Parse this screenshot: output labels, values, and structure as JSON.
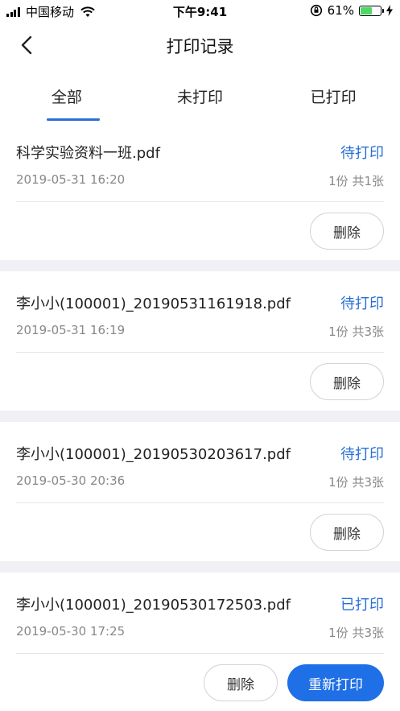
{
  "status_bar": {
    "carrier": "中国移动",
    "time": "下午9:41",
    "battery_percent": "61%",
    "battery_level": 0.61,
    "battery_color": "#4cd964"
  },
  "nav": {
    "title": "打印记录",
    "back_icon": "chevron-left-icon"
  },
  "tabs": [
    {
      "label": "全部",
      "active": true
    },
    {
      "label": "未打印",
      "active": false
    },
    {
      "label": "已打印",
      "active": false
    }
  ],
  "colors": {
    "accent": "#2a6fd6",
    "primary_button": "#1f6fe6",
    "background": "#f1f1f5"
  },
  "records": [
    {
      "name": "科学实验资料一班.pdf",
      "status": "待打印",
      "date": "2019-05-31 16:20",
      "count": "1份  共1张",
      "delete_label": "删除"
    },
    {
      "name": "李小小(100001)_20190531161918.pdf",
      "status": "待打印",
      "date": "2019-05-31 16:19",
      "count": "1份  共3张",
      "delete_label": "删除"
    },
    {
      "name": "李小小(100001)_20190530203617.pdf",
      "status": "待打印",
      "date": "2019-05-30 20:36",
      "count": "1份  共3张",
      "delete_label": "删除"
    },
    {
      "name": "李小小(100001)_20190530172503.pdf",
      "status": "已打印",
      "date": "2019-05-30 17:25",
      "count": "1份  共3张",
      "delete_label": "删除",
      "reprint_label": "重新打印"
    }
  ]
}
